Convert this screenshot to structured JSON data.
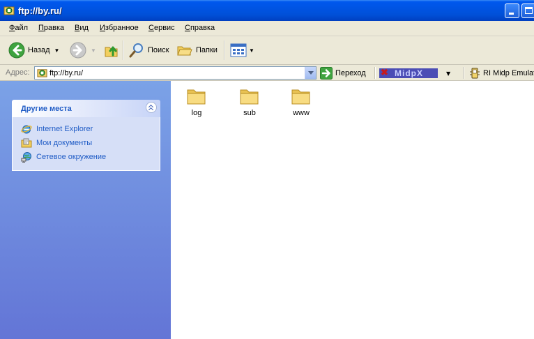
{
  "window": {
    "title": "ftp://by.ru/"
  },
  "menu": [
    "Файл",
    "Правка",
    "Вид",
    "Избранное",
    "Сервис",
    "Справка"
  ],
  "toolbar": {
    "back": "Назад",
    "search": "Поиск",
    "folders": "Папки"
  },
  "address": {
    "label": "Адрес:",
    "value": "ftp://by.ru/",
    "go": "Переход"
  },
  "links": {
    "midp_logo": "MidpX",
    "ri_midp": "RI Midp Emulator"
  },
  "other_places": {
    "title": "Другие места",
    "items": [
      "Internet Explorer",
      "Мои документы",
      "Сетевое окружение"
    ]
  },
  "folders": [
    "log",
    "sub",
    "www"
  ],
  "colors": {
    "title_bar": "#0054e3",
    "pane_top": "#7ba2e7",
    "pane_bottom": "#6375d6",
    "link_blue": "#215dc6"
  },
  "icons": [
    "folder-icon",
    "back-arrow-icon",
    "forward-arrow-icon",
    "up-folder-icon",
    "search-icon",
    "folders-icon",
    "views-icon",
    "go-arrow-icon",
    "ie-icon",
    "my-documents-icon",
    "network-icon"
  ]
}
